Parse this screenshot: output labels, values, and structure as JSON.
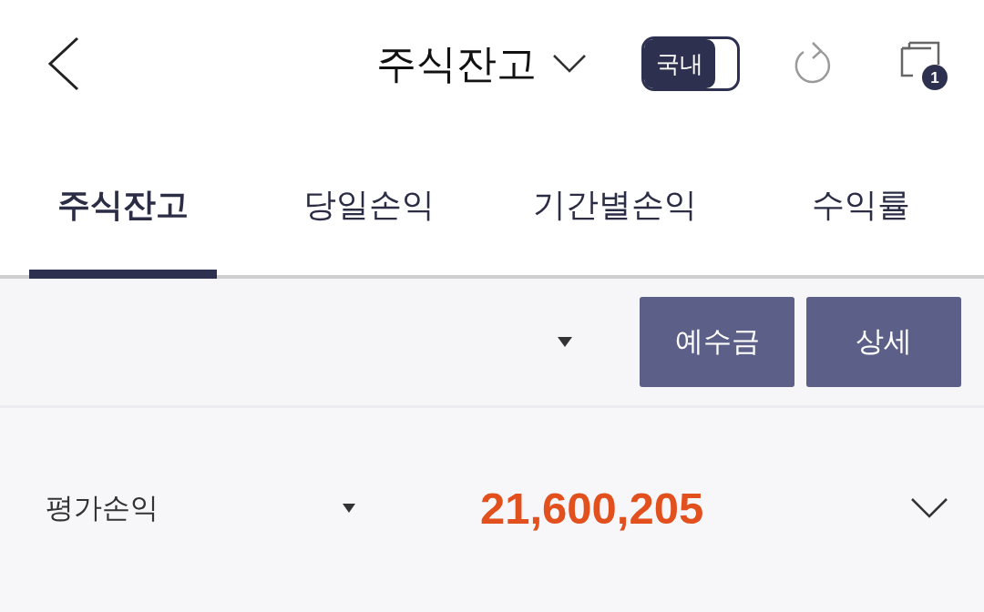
{
  "header": {
    "title": "주식잔고",
    "market_toggle": {
      "label": "국내",
      "on": true
    },
    "badge": "1"
  },
  "tabs": [
    {
      "label": "주식잔고",
      "selected": true
    },
    {
      "label": "당일손익",
      "selected": false
    },
    {
      "label": "기간별손익",
      "selected": false
    },
    {
      "label": "수익률",
      "selected": false
    }
  ],
  "toolbar": {
    "buttons": [
      "예수금",
      "상세"
    ]
  },
  "summary": {
    "label": "평가손익",
    "value": "21,600,205"
  }
}
